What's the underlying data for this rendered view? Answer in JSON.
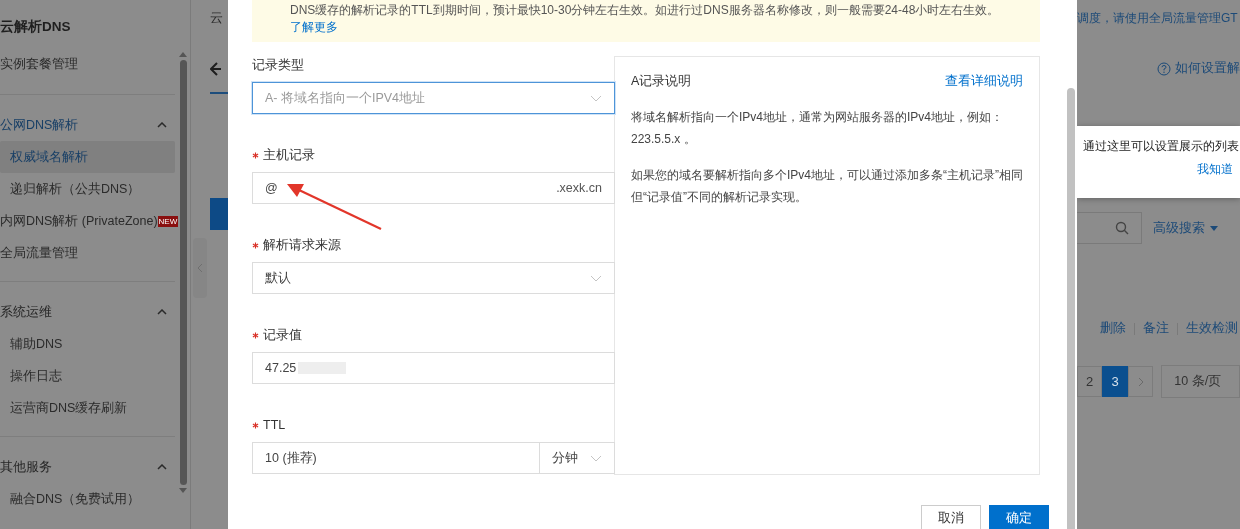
{
  "sidebar": {
    "title": "云解析DNS",
    "sections": [
      {
        "items": [
          {
            "label": "实例套餐管理",
            "kind": "top",
            "selected": false
          }
        ]
      },
      {
        "title": "公网DNS解析",
        "expanded": true,
        "active": true,
        "items": [
          {
            "label": "权威域名解析",
            "kind": "sub",
            "selected": true
          },
          {
            "label": "递归解析（公共DNS）",
            "kind": "sub",
            "selected": false
          },
          {
            "label": "内网DNS解析 (PrivateZone)",
            "kind": "top",
            "selected": false,
            "badge": "NEW"
          },
          {
            "label": "全局流量管理",
            "kind": "top",
            "selected": false
          }
        ]
      },
      {
        "title": "系统运维",
        "expanded": true,
        "active": false,
        "items": [
          {
            "label": "辅助DNS",
            "kind": "sub",
            "selected": false
          },
          {
            "label": "操作日志",
            "kind": "sub",
            "selected": false
          },
          {
            "label": "运营商DNS缓存刷新",
            "kind": "sub",
            "selected": false
          }
        ]
      },
      {
        "title": "其他服务",
        "expanded": true,
        "active": false,
        "items": [
          {
            "label": "融合DNS（免费试用）",
            "kind": "sub",
            "selected": false
          }
        ]
      }
    ]
  },
  "background": {
    "breadcrumb": "云",
    "notice": "调度，请使用全局流量管理GT",
    "help_link": "如何设置解",
    "tooltip": {
      "text": "通过这里可以设置展示的列表",
      "link": "我知道"
    },
    "advanced_search": "高级搜索",
    "row_actions": [
      "删除",
      "备注",
      "生效检测"
    ],
    "pagination": {
      "pages": [
        {
          "label": "2",
          "selected": false
        },
        {
          "label": "3",
          "selected": true
        }
      ],
      "page_size": "10 条/页"
    }
  },
  "dialog": {
    "notice": "DNS缓存的解析记录的TTL到期时间，预计最快10-30分钟左右生效。如进行过DNS服务器名称修改，则一般需要24-48小时左右生效。",
    "notice_link": "了解更多",
    "fields": [
      {
        "kind": "select",
        "label": "记录类型",
        "required": false,
        "placeholder": "A- 将域名指向一个IPV4地址",
        "focused": true
      },
      {
        "kind": "suffix",
        "label": "主机记录",
        "required": true,
        "value": "@",
        "suffix": ".xexk.cn",
        "focused": false
      },
      {
        "kind": "select",
        "label": "解析请求来源",
        "required": true,
        "value": "默认",
        "focused": false
      },
      {
        "kind": "redacted",
        "label": "记录值",
        "required": true,
        "value": "47.25",
        "focused": false
      },
      {
        "kind": "unit",
        "label": "TTL",
        "required": true,
        "value": "10 (推荐)",
        "unit": "分钟",
        "focused": false
      }
    ],
    "help": {
      "title": "A记录说明",
      "link": "查看详细说明",
      "paragraphs": [
        "将域名解析指向一个IPv4地址，通常为网站服务器的IPv4地址，例如：223.5.5.x 。",
        "如果您的域名要解析指向多个IPv4地址，可以通过添加多条“主机记录”相同但“记录值”不同的解析记录实现。"
      ]
    },
    "buttons": [
      {
        "label": "取消",
        "kind": "secondary"
      },
      {
        "label": "确定",
        "kind": "primary"
      }
    ]
  }
}
